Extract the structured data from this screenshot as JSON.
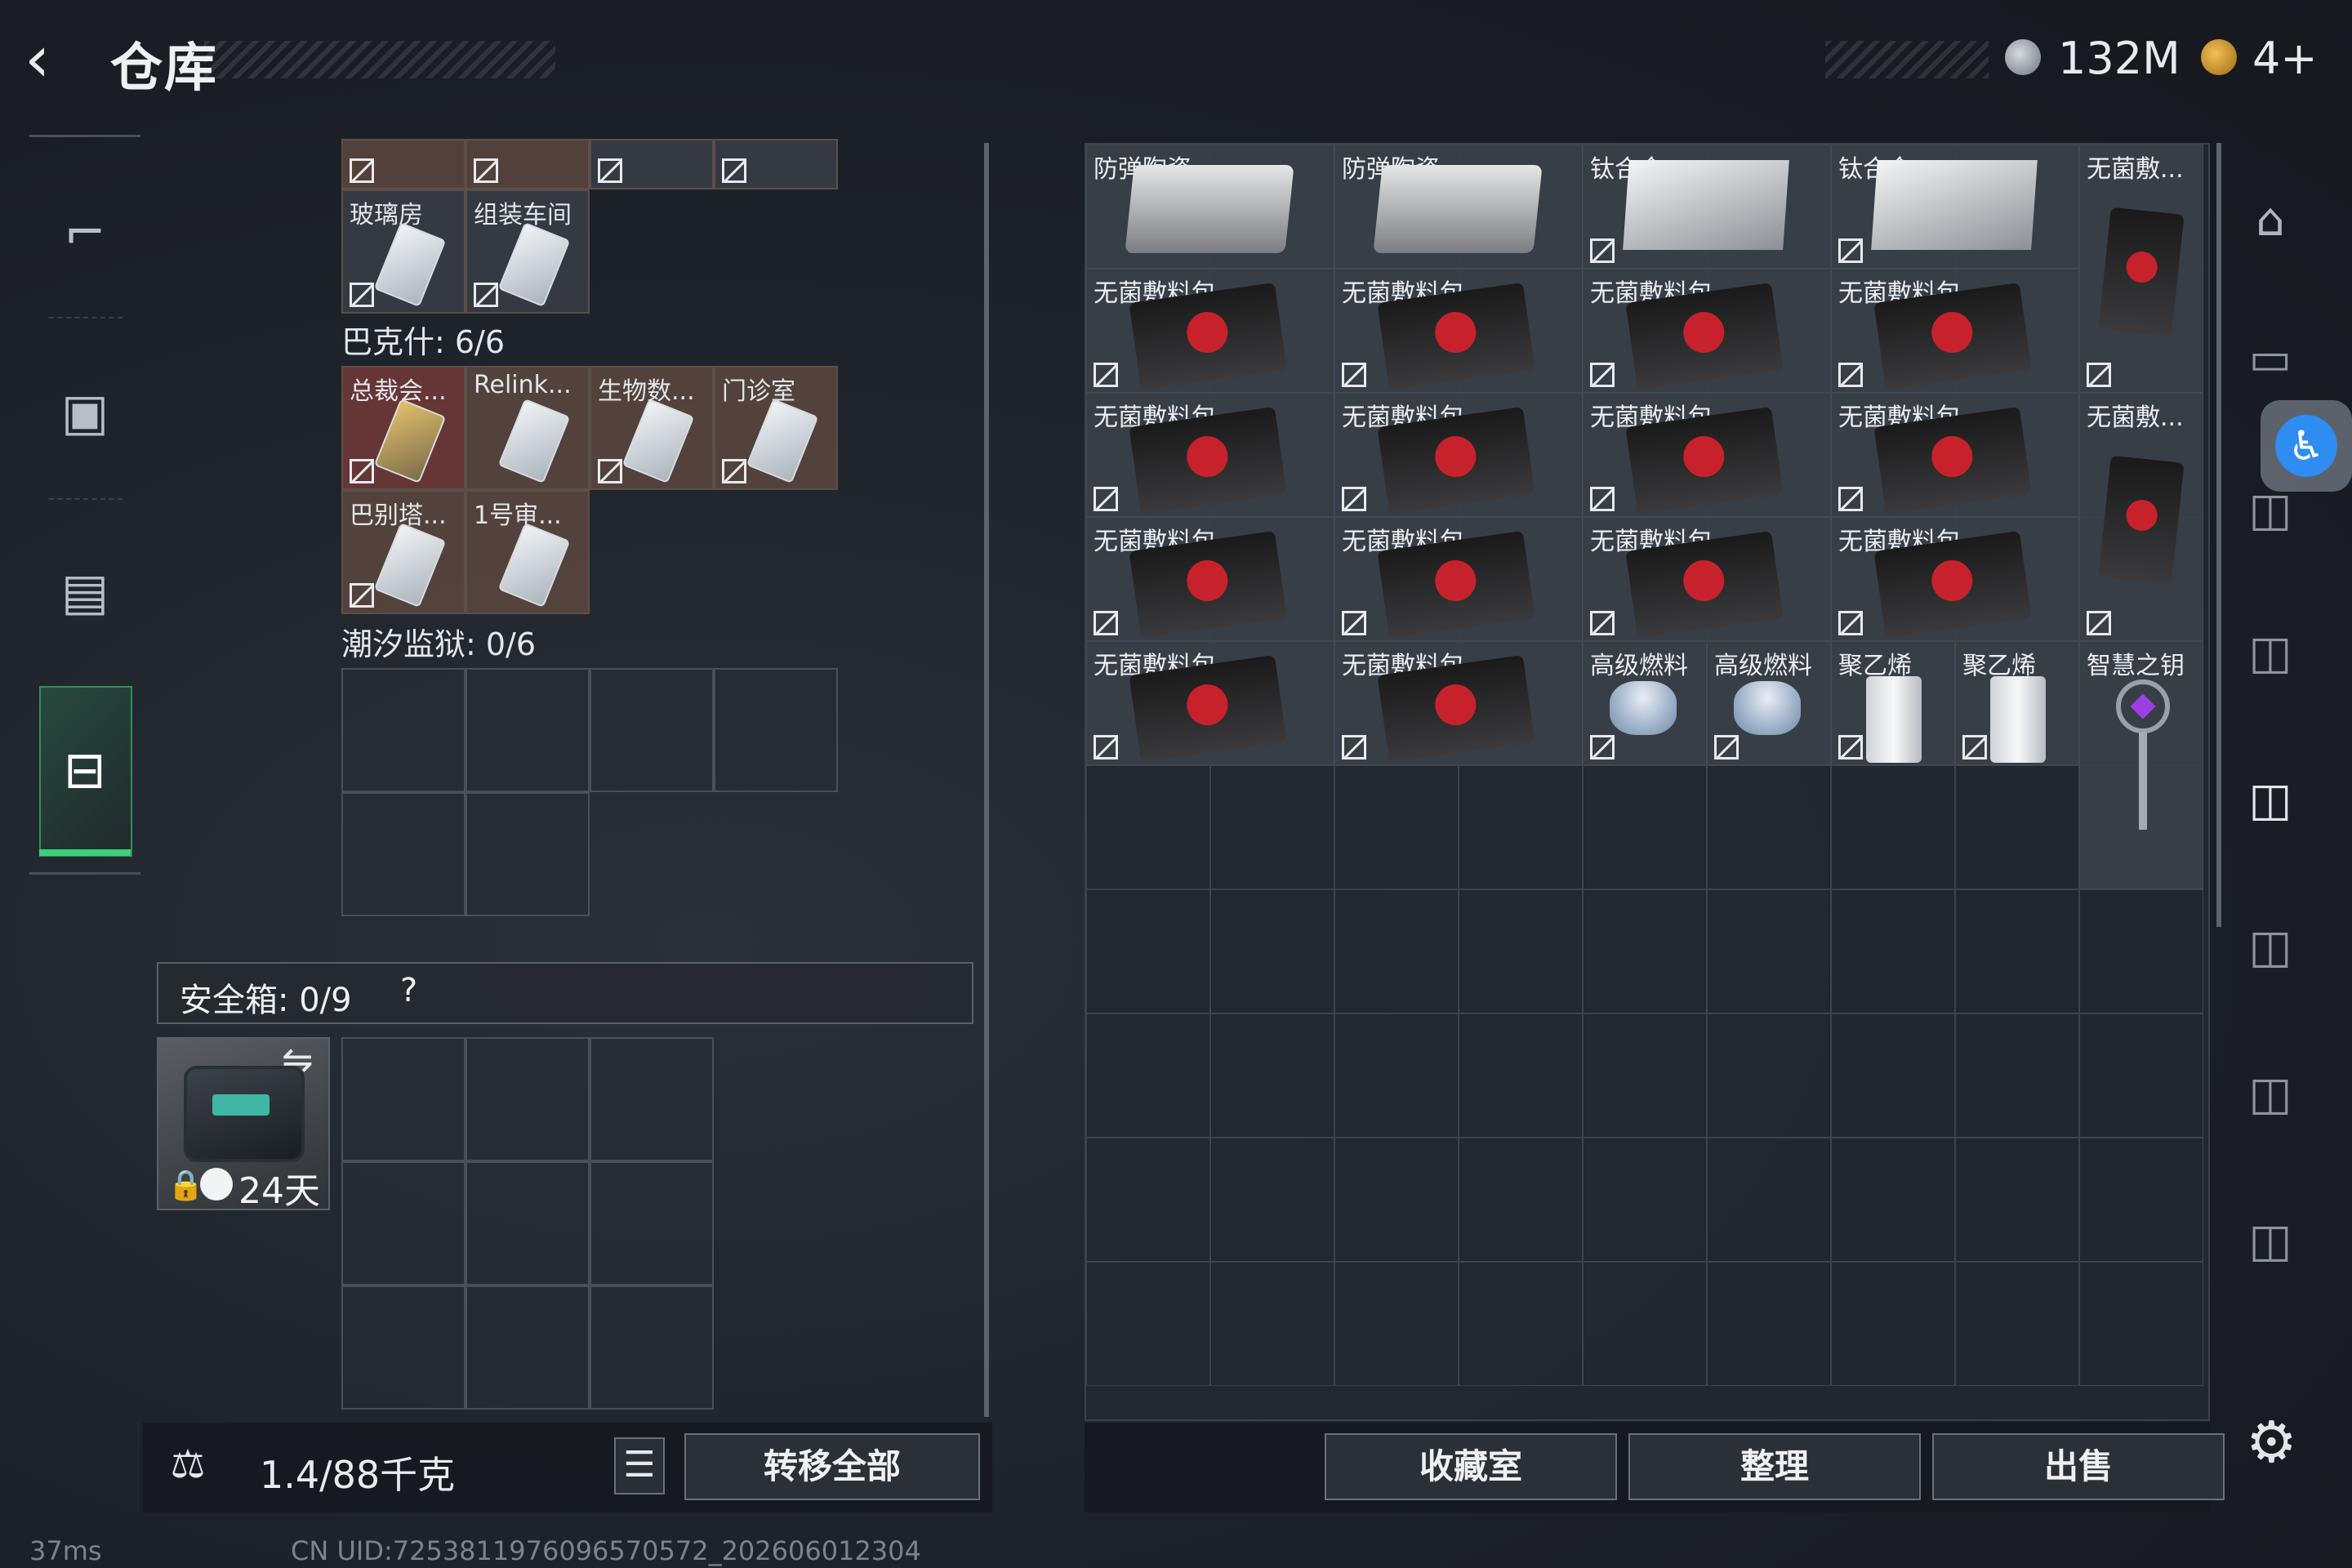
{
  "header": {
    "back_icon": "back-arrow-icon",
    "title": "仓库",
    "currency1_value": "132M",
    "currency2_value": "4+"
  },
  "left_nav": {
    "items": [
      {
        "name": "weapon-icon",
        "glyph": "⌐"
      },
      {
        "name": "backpack-icon",
        "glyph": "▣"
      },
      {
        "name": "vest-icon",
        "glyph": "▤"
      },
      {
        "name": "toolbox-icon",
        "glyph": "⊟"
      }
    ]
  },
  "sections": {
    "top_labels": [
      "玻璃房",
      "组装车间"
    ],
    "bakhsh": {
      "title": "巴克什: 6/6",
      "items": [
        "总裁会...",
        "Relink...",
        "生物数...",
        "门诊室",
        "巴别塔...",
        "1号审..."
      ]
    },
    "prison": {
      "title": "潮汐监狱: 0/6"
    }
  },
  "safe": {
    "label": "安全箱: 0/9",
    "help": "?",
    "swap_icon": "⇋",
    "lock_icon": "🔒",
    "days": "24天"
  },
  "left_bottom": {
    "kg_icon": "⚖",
    "weight": "1.4/88千克",
    "list_icon": "☰",
    "transfer_all": "转移全部"
  },
  "stash": {
    "row0": [
      "防弹陶瓷",
      "防弹陶瓷",
      "钛合金",
      "钛合金",
      "无菌敷..."
    ],
    "row1": [
      "无菌敷料包",
      "无菌敷料包",
      "无菌敷料包",
      "无菌敷料包"
    ],
    "row2": [
      "无菌敷料包",
      "无菌敷料包",
      "无菌敷料包",
      "无菌敷料包",
      "无菌敷..."
    ],
    "row3": [
      "无菌敷料包",
      "无菌敷料包",
      "无菌敷料包",
      "无菌敷料包"
    ],
    "row4": [
      "无菌敷料包",
      "无菌敷料包",
      "高级燃料",
      "高级燃料",
      "聚乙烯",
      "聚乙烯",
      "智慧之钥"
    ]
  },
  "right_bottom": {
    "collection": "收藏室",
    "organize": "整理",
    "sell": "出售",
    "settings_icon": "⚙"
  },
  "right_nav": {
    "glyphs": [
      "⌂",
      "▭",
      "◫",
      "◫",
      "◫",
      "◫",
      "◫",
      "◫"
    ]
  },
  "status": {
    "ping": "37ms",
    "uid": "CN UID:7253811976096570572_202606012304"
  },
  "colors": {
    "accent_green": "#3cd07a",
    "accessibility_blue": "#2f8cf0"
  }
}
